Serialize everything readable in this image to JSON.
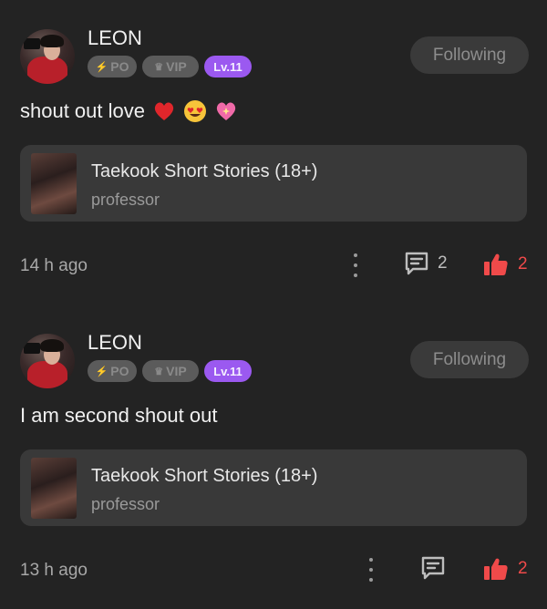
{
  "posts": [
    {
      "username": "LEON",
      "badges": {
        "po": "PO",
        "vip": "VIP",
        "level": "Lv.11"
      },
      "follow_label": "Following",
      "message": "shout out love",
      "emojis": [
        "red-heart",
        "heart-eyes",
        "sparkling-heart"
      ],
      "story": {
        "title": "Taekook Short Stories (18+)",
        "author": "professor"
      },
      "time": "14 h ago",
      "comment_count": "2",
      "like_count": "2"
    },
    {
      "username": "LEON",
      "badges": {
        "po": "PO",
        "vip": "VIP",
        "level": "Lv.11"
      },
      "follow_label": "Following",
      "message": "I am second shout out",
      "emojis": [],
      "story": {
        "title": "Taekook Short Stories (18+)",
        "author": "professor"
      },
      "time": "13 h ago",
      "comment_count": "",
      "like_count": "2"
    }
  ],
  "colors": {
    "background": "#232323",
    "card": "#393939",
    "level_badge": "#9b59f0",
    "like": "#f04a4a"
  }
}
